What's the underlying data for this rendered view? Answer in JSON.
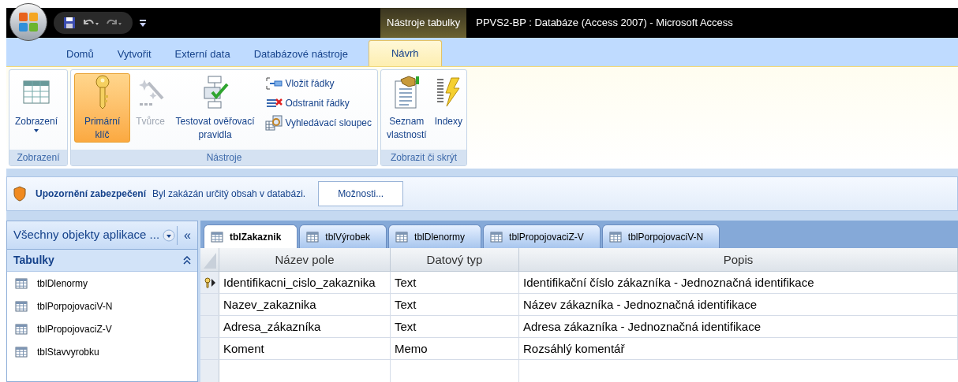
{
  "title_bar": {
    "context_label": "Nástroje tabulky",
    "title": "PPVS2-BP : Databáze (Access 2007) - Microsoft Access"
  },
  "ribbon_tabs": [
    {
      "label": "Domů",
      "selected": false
    },
    {
      "label": "Vytvořit",
      "selected": false
    },
    {
      "label": "Externí data",
      "selected": false
    },
    {
      "label": "Databázové nástroje",
      "selected": false
    },
    {
      "label": "Návrh",
      "selected": true
    }
  ],
  "ribbon_groups": [
    {
      "label": "Zobrazení",
      "buttons": [
        {
          "kind": "large_dropdown",
          "label": "Zobrazení",
          "on": false,
          "disabled": false
        }
      ]
    },
    {
      "label": "Nástroje",
      "buttons": [
        {
          "kind": "large",
          "label": "Primární klíč",
          "on": true,
          "disabled": false
        },
        {
          "kind": "large",
          "label": "Tvůrce",
          "on": false,
          "disabled": true
        },
        {
          "kind": "large",
          "label": "Testovat ověřovací pravidla",
          "on": false,
          "disabled": false
        },
        {
          "kind": "small",
          "label": "Vložit řádky",
          "on": false,
          "disabled": false
        },
        {
          "kind": "small",
          "label": "Odstranit řádky",
          "on": false,
          "disabled": false
        },
        {
          "kind": "small",
          "label": "Vyhledávací sloupec",
          "on": false,
          "disabled": false
        }
      ]
    },
    {
      "label": "Zobrazit či skrýt",
      "buttons": [
        {
          "kind": "large",
          "label": "Seznam vlastností",
          "on": false,
          "disabled": false
        },
        {
          "kind": "large",
          "label": "Indexy",
          "on": false,
          "disabled": false
        }
      ]
    }
  ],
  "security_bar": {
    "title": "Upozornění zabezpečení",
    "message": "Byl zakázán určitý obsah v databázi.",
    "button": "Možnosti..."
  },
  "nav_pane": {
    "header": "Všechny objekty aplikace ...",
    "collapse": "«",
    "section": "Tabulky",
    "items": [
      "tblDlenormy",
      "tblPorpojovaciV-N",
      "tblPropojovaciZ-V",
      "tblStavvyrobku"
    ]
  },
  "document_tabs": [
    {
      "label": "tblZakaznik",
      "selected": true
    },
    {
      "label": "tblVýrobek",
      "selected": false
    },
    {
      "label": "tblDlenormy",
      "selected": false
    },
    {
      "label": "tblPropojovaciZ-V",
      "selected": false
    },
    {
      "label": "tblPorpojovaciV-N",
      "selected": false
    }
  ],
  "table": {
    "columns": [
      "Název pole",
      "Datový typ",
      "Popis"
    ],
    "rows": [
      {
        "cells": [
          "Identifikacni_cislo_zakaznika",
          "Text",
          "Identifikační číslo zákazníka - Jednoznačná identifikace"
        ],
        "primary_key": true,
        "current": true
      },
      {
        "cells": [
          "Nazev_zakaznika",
          "Text",
          "Název zákazníka - Jednoznačná identifikace"
        ],
        "primary_key": false,
        "current": false
      },
      {
        "cells": [
          "Adresa_zákazníka",
          "Text",
          "Adresa zákazníka - Jednoznačná identifikace"
        ],
        "primary_key": false,
        "current": false
      },
      {
        "cells": [
          "Koment",
          "Memo",
          "Rozsáhlý komentář"
        ],
        "primary_key": false,
        "current": false
      }
    ]
  }
}
